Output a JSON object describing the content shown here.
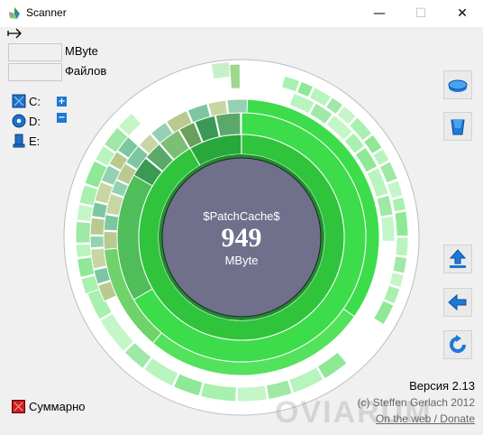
{
  "window": {
    "title": "Scanner",
    "minimize": "—",
    "maximize": "☐",
    "close": "✕"
  },
  "fields": {
    "size_unit": "MByte",
    "files_label": "Файлов"
  },
  "drives": [
    {
      "label": "C:",
      "icon": "hard-drive-icon"
    },
    {
      "label": "D:",
      "icon": "cd-drive-icon"
    },
    {
      "label": "E:",
      "icon": "usb-drive-icon"
    }
  ],
  "tree_buttons": {
    "expand": "+",
    "collapse": "−"
  },
  "center": {
    "name": "$PatchCache$",
    "size": "949",
    "unit": "MByte"
  },
  "summary": {
    "label": "Суммарно"
  },
  "footer": {
    "version": "Версия 2.13",
    "copyright": "(c) Steffen Gerlach 2012",
    "link": "On the web / Donate"
  },
  "watermark": "OVIARUM",
  "colors": {
    "center": "#70708c",
    "ring1": "#1e8c2c",
    "ring2": "#2fc43c",
    "ring3": "#3ddc4a",
    "outer": "#6fe87a"
  }
}
